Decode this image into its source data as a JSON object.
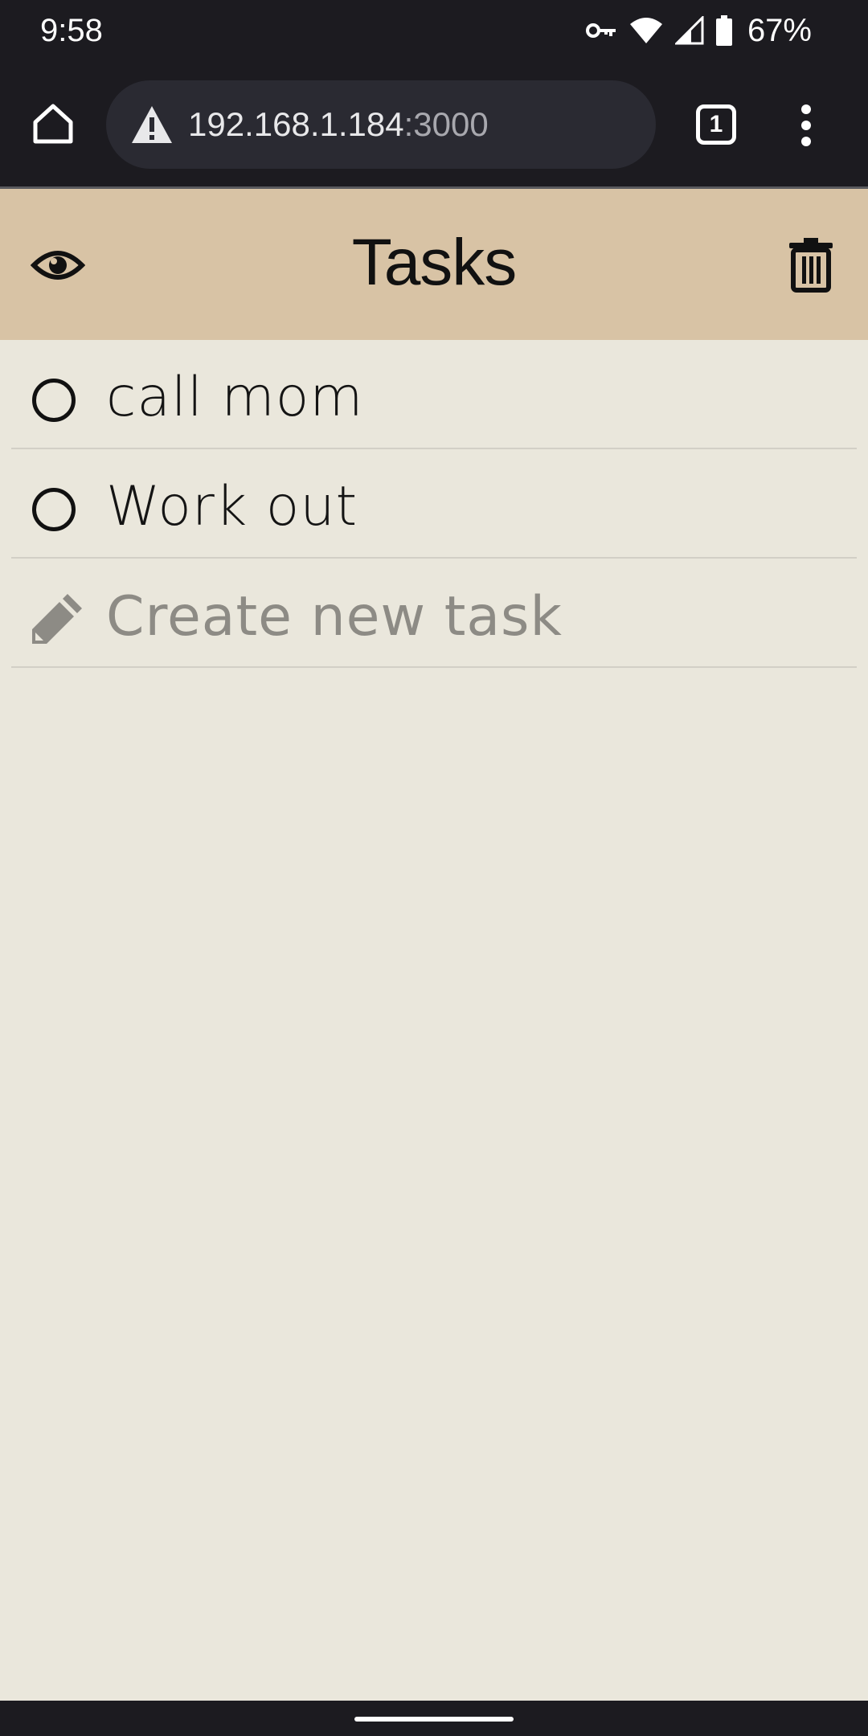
{
  "status_bar": {
    "time": "9:58",
    "battery_percent": "67%",
    "icons": [
      "vpn-key-icon",
      "wifi-icon",
      "signal-icon",
      "battery-icon"
    ]
  },
  "browser": {
    "url_host": "192.168.1.184",
    "url_port": ":3000",
    "tab_count": "1",
    "icons": [
      "home-icon",
      "warning-icon",
      "tabs-icon",
      "overflow-menu-icon"
    ]
  },
  "app": {
    "title": "Tasks",
    "header_color": "#d8c3a5",
    "background_color": "#eae7dc",
    "icons": [
      "eye-icon",
      "trash-icon"
    ]
  },
  "tasks": [
    {
      "label": "call mom",
      "completed": false
    },
    {
      "label": "Work out",
      "completed": false
    }
  ],
  "new_task": {
    "placeholder": "Create new task",
    "icon": "pencil-icon"
  }
}
